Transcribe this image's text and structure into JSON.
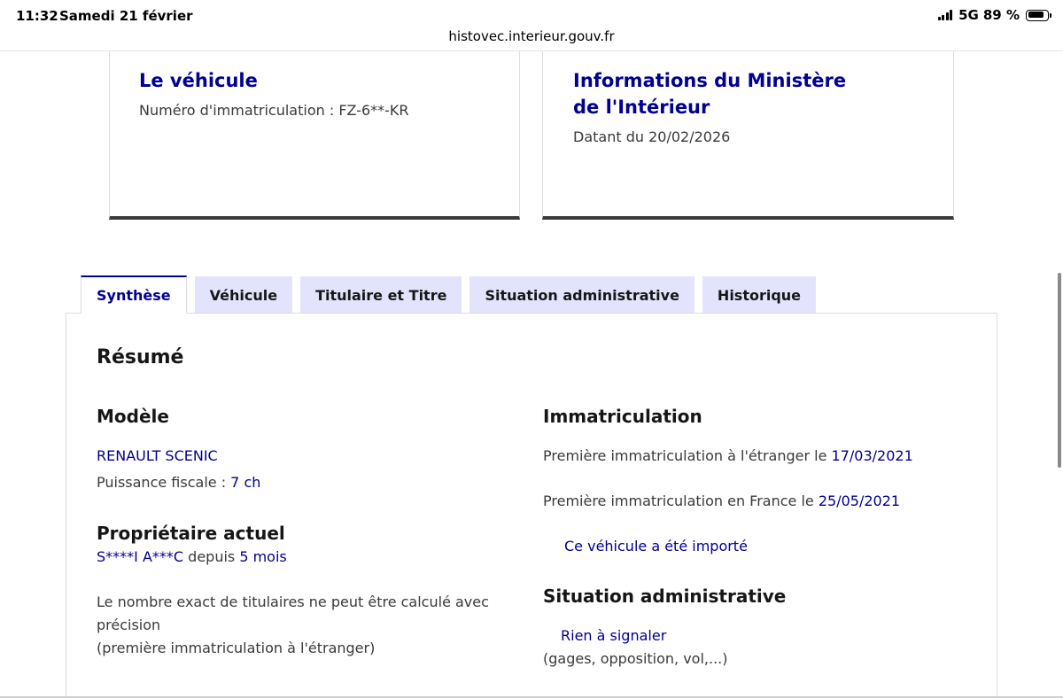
{
  "status_bar": {
    "time": "11:32",
    "date": "Samedi 21 février",
    "network": "5G",
    "battery": "89 %",
    "battery_level": 0.89,
    "url": "histovec.interieur.gouv.fr"
  },
  "cards": {
    "vehicule": {
      "title": "Le véhicule",
      "text": "Numéro d'immatriculation : FZ-6**-KR"
    },
    "ministere": {
      "title": "Informations du Ministère de l'Intérieur",
      "text": "Datant du 20/02/2026"
    }
  },
  "tabs": [
    "Synthèse",
    "Véhicule",
    "Titulaire et Titre",
    "Situation administrative",
    "Historique"
  ],
  "active_tab": "Synthèse",
  "summary": {
    "title": "Résumé",
    "modele": {
      "heading": "Modèle",
      "model_name": "RENAULT SCENIC",
      "puissance_label": "Puissance fiscale : ",
      "puissance_value": "7 ch"
    },
    "proprietaire": {
      "heading": "Propriétaire actuel",
      "name": "S****I A***C",
      "depuis": " depuis ",
      "duree": "5 mois",
      "note_line1": "Le nombre exact de titulaires ne peut être calculé avec",
      "note_line2": "précision",
      "note_line3": "(première immatriculation à l'étranger)"
    },
    "immatriculation": {
      "heading": "Immatriculation",
      "etranger_label": "Première immatriculation à l'étranger le ",
      "etranger_date": "17/03/2021",
      "france_label": "Première immatriculation en France le ",
      "france_date": "25/05/2021",
      "importe": "Ce véhicule a été importé"
    },
    "situation": {
      "heading": "Situation administrative",
      "status": "Rien à signaler",
      "details": "(gages, opposition, vol,...)"
    }
  },
  "colors": {
    "primary_blue": "#000091",
    "tab_background": "#e3e3fd",
    "card_border_bottom": "#3a3a3a"
  }
}
